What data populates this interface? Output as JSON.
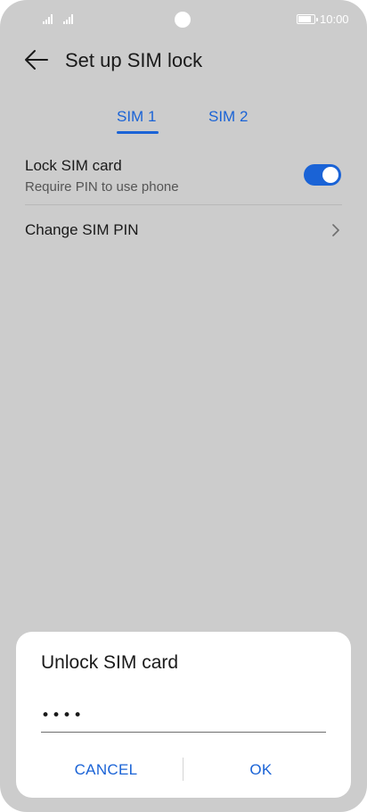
{
  "status_bar": {
    "time": "10:00",
    "battery_level": 0.85,
    "signal_icons": [
      "signal-icon",
      "signal-icon"
    ],
    "battery_icon": "battery-icon"
  },
  "header": {
    "back_icon": "arrow-left-icon",
    "title": "Set up SIM lock"
  },
  "tabs": [
    {
      "label": "SIM 1",
      "selected": true
    },
    {
      "label": "SIM 2",
      "selected": false
    }
  ],
  "settings": {
    "lock_sim": {
      "title": "Lock SIM card",
      "subtitle": "Require PIN to use phone",
      "enabled": true
    },
    "change_pin": {
      "label": "Change SIM PIN",
      "icon": "chevron-right-icon"
    }
  },
  "dialog": {
    "title": "Unlock SIM card",
    "pin_value": "1234",
    "cancel_label": "CANCEL",
    "ok_label": "OK"
  },
  "colors": {
    "accent": "#1a63d6",
    "background": "#cccccc",
    "dialog": "#ffffff"
  }
}
